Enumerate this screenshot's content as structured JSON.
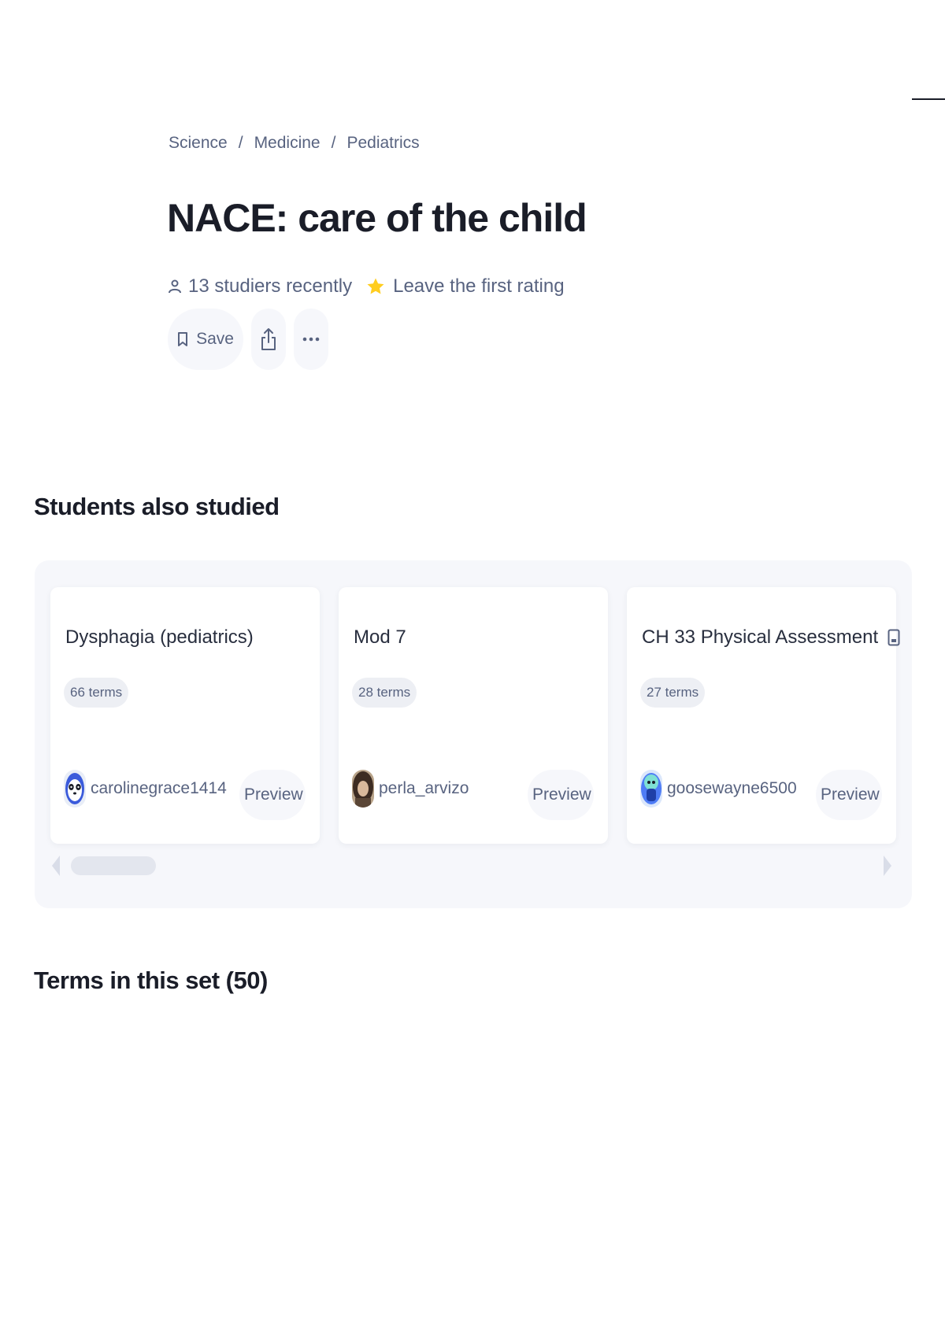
{
  "breadcrumb": {
    "items": [
      "Science",
      "Medicine",
      "Pediatrics"
    ],
    "separator": "/"
  },
  "header": {
    "title": "NACE: care of the child",
    "studiers": "13 studiers recently",
    "rating": "Leave the first rating"
  },
  "actions": {
    "save_label": "Save"
  },
  "sections": {
    "also_studied": "Students also studied",
    "terms": "Terms in this set (50)"
  },
  "cards": [
    {
      "title": "Dysphagia (pediatrics)",
      "terms": "66 terms",
      "author": "carolinegrace1414",
      "preview": "Preview",
      "has_icon": false
    },
    {
      "title": "Mod 7",
      "terms": "28 terms",
      "author": "perla_arvizo",
      "preview": "Preview",
      "has_icon": false
    },
    {
      "title": "CH 33 Physical Assessment",
      "terms": "27 terms",
      "author": "goosewayne6500",
      "preview": "Preview",
      "has_icon": true,
      "icon": "tablet-icon"
    }
  ],
  "colors": {
    "text_primary": "#1a1d28",
    "text_secondary": "#586380",
    "panel_bg": "#f6f7fb",
    "star": "#ffcd1f"
  },
  "icons": [
    "people-icon",
    "star-icon",
    "bookmark-icon",
    "share-icon",
    "more-icon",
    "tablet-icon",
    "chevron-left-icon",
    "chevron-right-icon"
  ]
}
